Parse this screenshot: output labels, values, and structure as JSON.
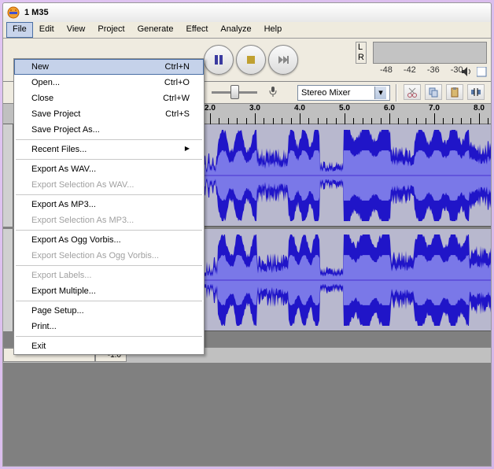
{
  "title": "1 M35",
  "menubar": [
    "File",
    "Edit",
    "View",
    "Project",
    "Generate",
    "Effect",
    "Analyze",
    "Help"
  ],
  "file_menu": [
    {
      "label": "New",
      "shortcut": "Ctrl+N",
      "highlight": true
    },
    {
      "label": "Open...",
      "shortcut": "Ctrl+O"
    },
    {
      "label": "Close",
      "shortcut": "Ctrl+W"
    },
    {
      "label": "Save Project",
      "shortcut": "Ctrl+S"
    },
    {
      "label": "Save Project As..."
    },
    {
      "sep": true
    },
    {
      "label": "Recent Files...",
      "submenu": true
    },
    {
      "sep": true
    },
    {
      "label": "Export As WAV..."
    },
    {
      "label": "Export Selection As WAV...",
      "disabled": true
    },
    {
      "sep": true
    },
    {
      "label": "Export As MP3..."
    },
    {
      "label": "Export Selection As MP3...",
      "disabled": true
    },
    {
      "sep": true
    },
    {
      "label": "Export As Ogg Vorbis..."
    },
    {
      "label": "Export Selection As Ogg Vorbis...",
      "disabled": true
    },
    {
      "sep": true
    },
    {
      "label": "Export Labels...",
      "disabled": true
    },
    {
      "label": "Export Multiple..."
    },
    {
      "sep": true
    },
    {
      "label": "Page Setup..."
    },
    {
      "label": "Print..."
    },
    {
      "sep": true
    },
    {
      "label": "Exit"
    }
  ],
  "meter": {
    "L": "L",
    "R": "R",
    "db": [
      "-48",
      "-42",
      "-36",
      "-30"
    ]
  },
  "mixer": {
    "label": "Stereo Mixer"
  },
  "ruler": {
    "labels": [
      "2.0",
      "3.0",
      "4.0",
      "5.0",
      "6.0",
      "7.0",
      "8.0"
    ]
  },
  "status": {
    "time": "-1.0"
  }
}
